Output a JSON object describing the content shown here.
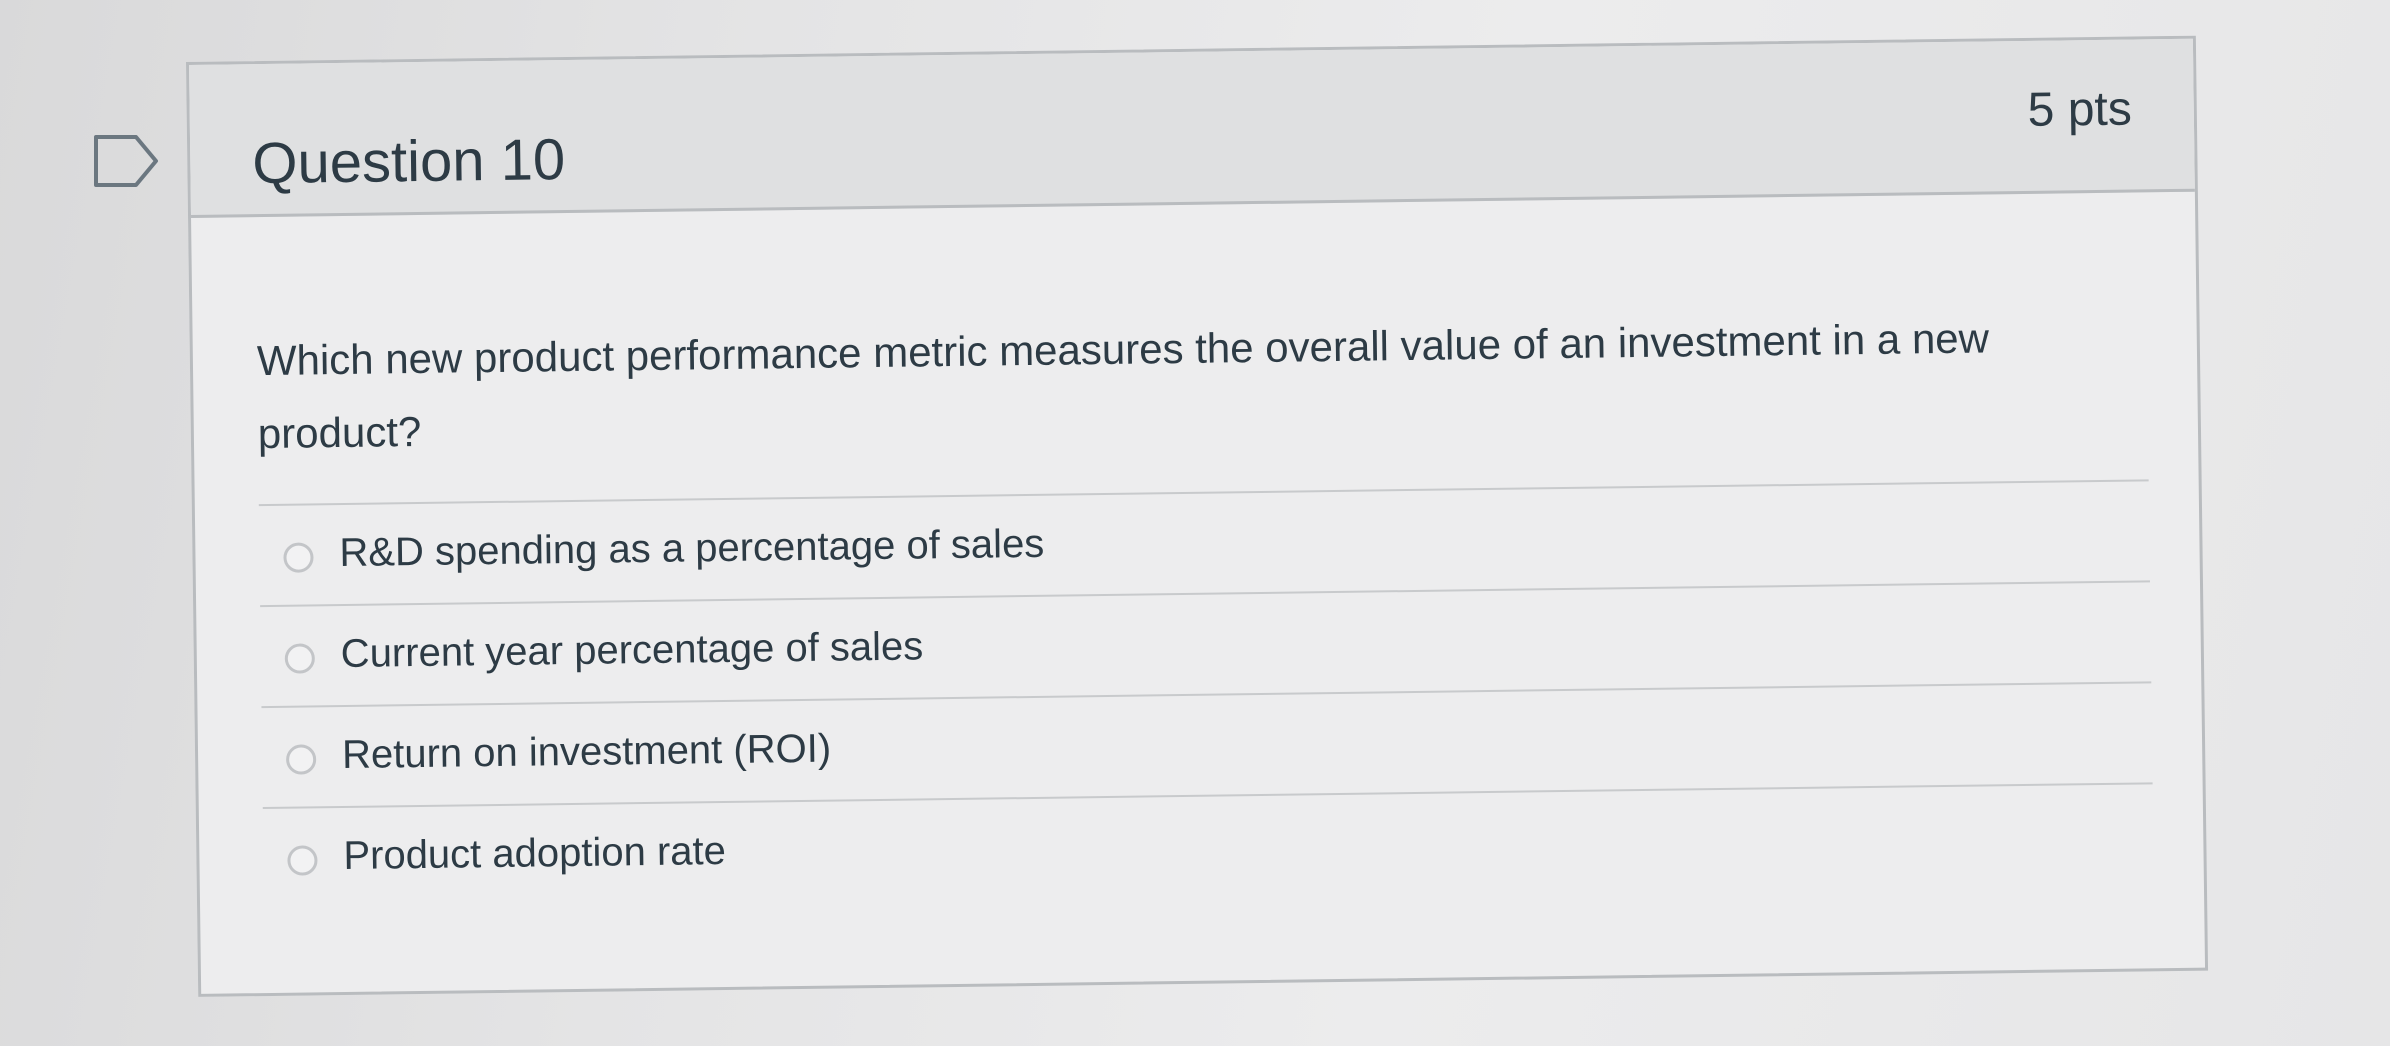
{
  "question": {
    "title": "Question 10",
    "points": "5 pts",
    "text": "Which new product performance metric measures the overall value of an investment in a new product?"
  },
  "answers": [
    {
      "label": "R&D spending as a percentage of sales"
    },
    {
      "label": "Current year percentage of sales"
    },
    {
      "label": "Return on investment (ROI)"
    },
    {
      "label": "Product adoption rate"
    }
  ],
  "icons": {
    "flag": "flag-icon",
    "radio": "radio-button"
  },
  "colors": {
    "text": "#2d3b45",
    "border": "#b9bcbf",
    "header_bg": "#dfe0e1",
    "card_bg": "#ededee"
  }
}
